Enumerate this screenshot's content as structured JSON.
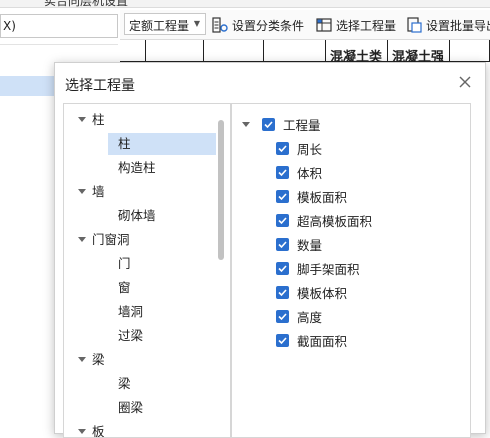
{
  "app": {
    "partial_title": "实合同层机设置"
  },
  "left": {
    "input_value": "X)"
  },
  "toolbar": {
    "dropdown_value": "定额工程量",
    "set_category": "设置分类条件",
    "select_quantity": "选择工程量",
    "set_batch_export": "设置批量导出"
  },
  "grid": {
    "header_partial_1": "混凝土类",
    "header_partial_2": "混凝土强"
  },
  "dialog": {
    "title": "选择工程量",
    "tree": [
      {
        "label": "柱",
        "level": 0,
        "expanded": true,
        "selected": false
      },
      {
        "label": "柱",
        "level": 1,
        "selected": true
      },
      {
        "label": "构造柱",
        "level": 1,
        "selected": false
      },
      {
        "label": "墙",
        "level": 0,
        "expanded": true,
        "selected": false
      },
      {
        "label": "砌体墙",
        "level": 1,
        "selected": false
      },
      {
        "label": "门窗洞",
        "level": 0,
        "expanded": true,
        "selected": false
      },
      {
        "label": "门",
        "level": 1,
        "selected": false
      },
      {
        "label": "窗",
        "level": 1,
        "selected": false
      },
      {
        "label": "墙洞",
        "level": 1,
        "selected": false
      },
      {
        "label": "过梁",
        "level": 1,
        "selected": false
      },
      {
        "label": "梁",
        "level": 0,
        "expanded": true,
        "selected": false
      },
      {
        "label": "梁",
        "level": 1,
        "selected": false
      },
      {
        "label": "圈梁",
        "level": 1,
        "selected": false
      },
      {
        "label": "板",
        "level": 0,
        "expanded": true,
        "selected": false
      }
    ],
    "quantities_root": {
      "label": "工程量",
      "checked": true
    },
    "quantities": [
      {
        "label": "周长",
        "checked": true
      },
      {
        "label": "体积",
        "checked": true
      },
      {
        "label": "模板面积",
        "checked": true
      },
      {
        "label": "超高模板面积",
        "checked": true
      },
      {
        "label": "数量",
        "checked": true
      },
      {
        "label": "脚手架面积",
        "checked": true
      },
      {
        "label": "模板体积",
        "checked": true
      },
      {
        "label": "高度",
        "checked": true
      },
      {
        "label": "截面面积",
        "checked": true
      }
    ]
  },
  "colors": {
    "accent": "#2b6fce",
    "selection": "#cfe1f7"
  }
}
